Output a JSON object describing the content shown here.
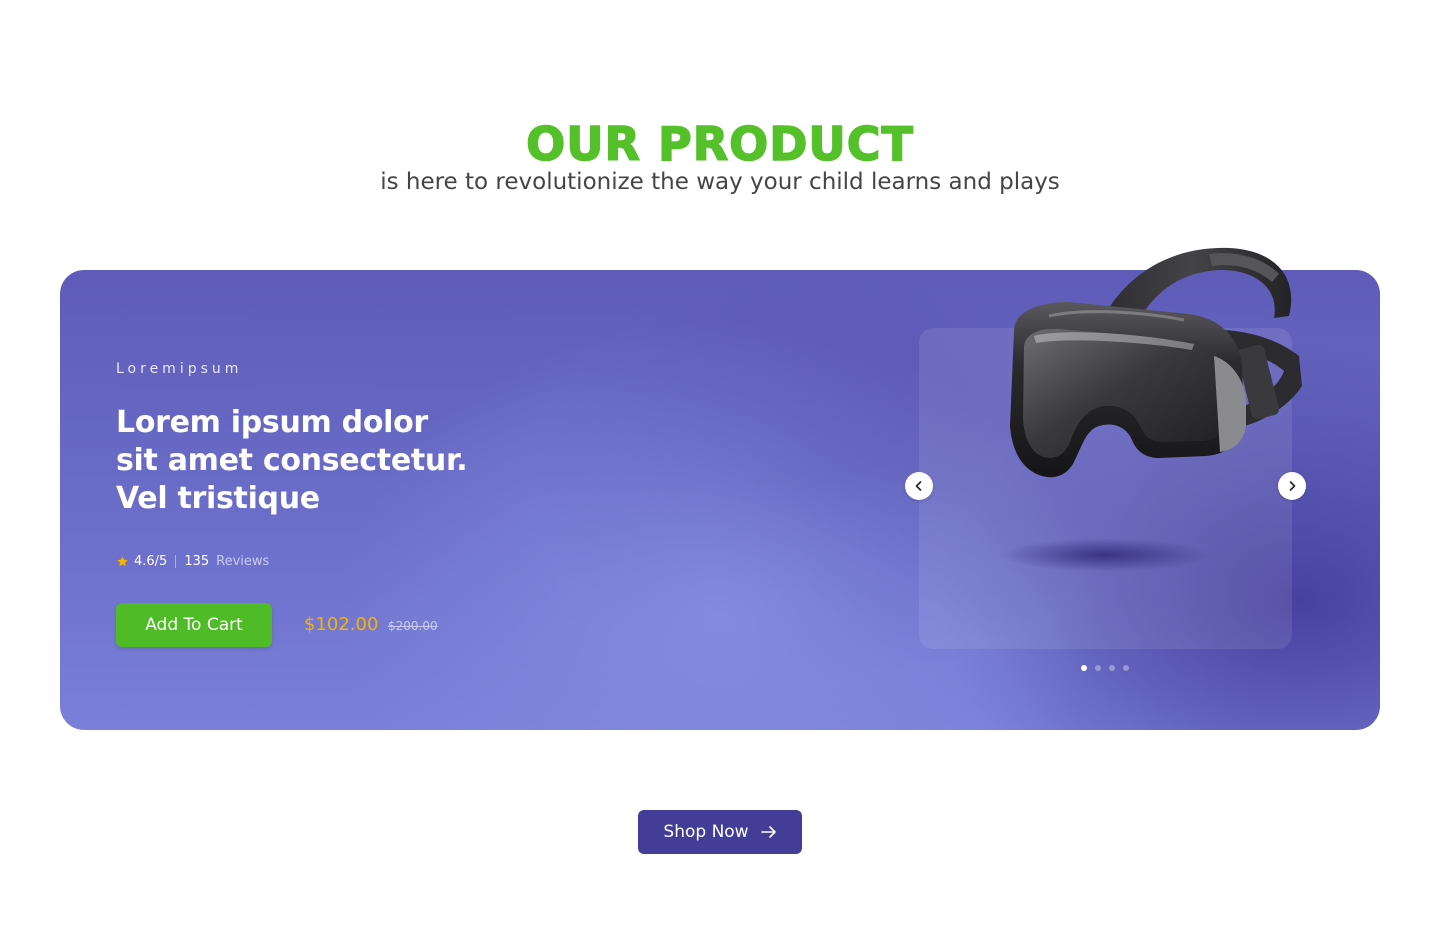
{
  "section": {
    "title": "Our Product",
    "subtitle": "is here to revolutionize the way your child learns and plays"
  },
  "banner": {
    "eyebrow": "Loremipsum",
    "headline": "Lorem ipsum dolor sit amet consectetur. Vel tristique",
    "rating": "4.6/5",
    "review_count": "135",
    "reviews_label": "Reviews",
    "add_to_cart_label": "Add To Cart",
    "price": "$102.00",
    "old_price": "$200.00",
    "carousel": {
      "slide_count": 4,
      "active_slide": 1,
      "prev_icon": "chevron-left-icon",
      "next_icon": "chevron-right-icon",
      "product_image": "vr-headset"
    }
  },
  "cta": {
    "shop_now_label": "Shop Now",
    "icon": "arrow-right-icon"
  },
  "colors": {
    "title_green": "#54c02a",
    "button_green": "#4fbb27",
    "banner_purple": "#6c6ec9",
    "shop_now_purple": "#433d97",
    "price_gold": "#f4b400",
    "star_gold": "#f4b400"
  }
}
